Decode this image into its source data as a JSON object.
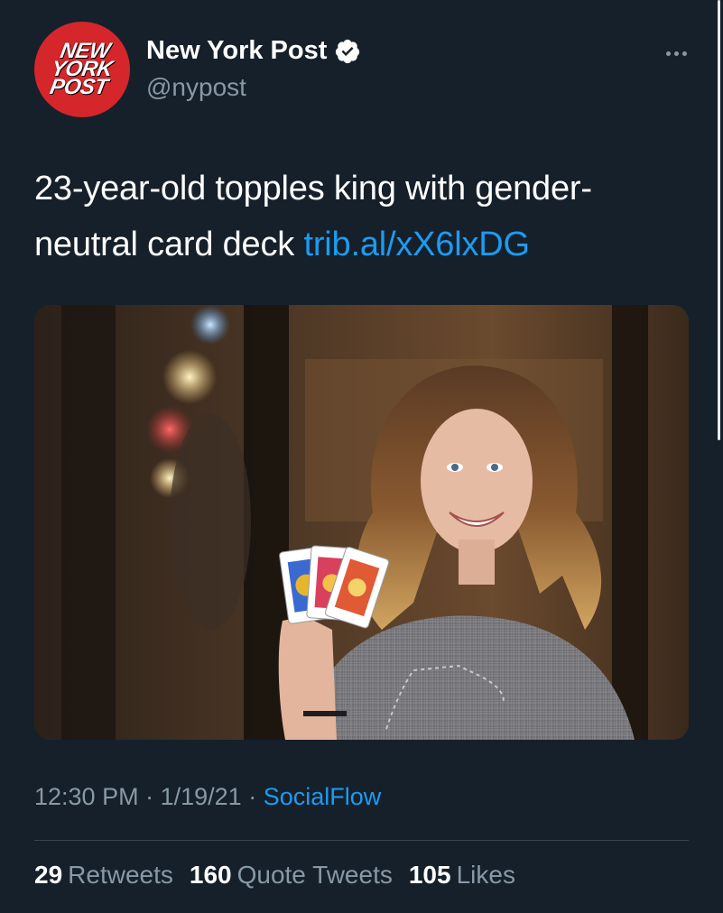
{
  "author": {
    "name": "New York Post",
    "handle": "@nypost",
    "avatar_lines": [
      "NEW",
      "YORK",
      "POST"
    ],
    "verified": true
  },
  "tweet": {
    "text": "23-year-old topples king with gender-neutral card deck",
    "link": "trib.al/xX6lxDG"
  },
  "meta": {
    "time": "12:30 PM",
    "separator": "·",
    "date": "1/19/21",
    "source": "SocialFlow"
  },
  "stats": {
    "retweets_count": "29",
    "retweets_label": "Retweets",
    "quotes_count": "160",
    "quotes_label": "Quote Tweets",
    "likes_count": "105",
    "likes_label": "Likes"
  },
  "colors": {
    "background": "#15202b",
    "link": "#1d9bf0",
    "secondary_text": "#8899a6",
    "brand_red": "#d4262b"
  },
  "icons": {
    "verified": "verified-badge-icon",
    "more": "more-options-icon"
  }
}
